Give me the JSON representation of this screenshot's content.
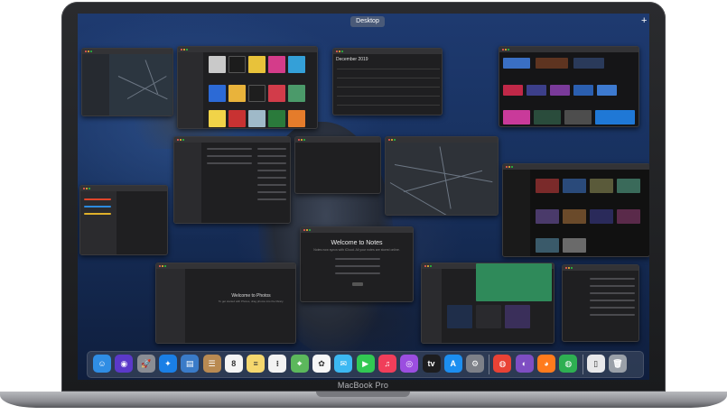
{
  "mission_control": {
    "space_label": "Desktop",
    "add_space_symbol": "+"
  },
  "calendar": {
    "month_title": "December 2019"
  },
  "notes": {
    "welcome_title": "Welcome to Notes",
    "welcome_subtitle": "Notes now syncs with iCloud. All your notes are stored online."
  },
  "photos": {
    "welcome_title": "Welcome to Photos",
    "welcome_subtitle": "To get started with Photos, drag photos into the library."
  },
  "laptop": {
    "model_label": "MacBook Pro"
  },
  "dock": {
    "icons": [
      {
        "name": "finder-icon",
        "glyph": "☺",
        "color": "#2f8de4"
      },
      {
        "name": "siri-icon",
        "glyph": "◉",
        "color": "#5b39c9"
      },
      {
        "name": "launchpad-icon",
        "glyph": "🚀",
        "color": "#8a8d94"
      },
      {
        "name": "safari-icon",
        "glyph": "✦",
        "color": "#1a7fe6"
      },
      {
        "name": "preview-icon",
        "glyph": "▤",
        "color": "#3a7bc8"
      },
      {
        "name": "contacts-icon",
        "glyph": "☰",
        "color": "#b98a52"
      },
      {
        "name": "calendar-icon",
        "glyph": "8",
        "color": "#f4f4f4"
      },
      {
        "name": "notes-icon",
        "glyph": "≡",
        "color": "#f5d76e"
      },
      {
        "name": "reminders-icon",
        "glyph": "⁝",
        "color": "#f2f2f2"
      },
      {
        "name": "maps-icon",
        "glyph": "⌖",
        "color": "#5cb85c"
      },
      {
        "name": "photos-icon",
        "glyph": "✿",
        "color": "#f7f7f7"
      },
      {
        "name": "messages-icon",
        "glyph": "✉",
        "color": "#3cb8f2"
      },
      {
        "name": "facetime-icon",
        "glyph": "▶",
        "color": "#32c853"
      },
      {
        "name": "music-icon",
        "glyph": "♫",
        "color": "#f03e5a"
      },
      {
        "name": "podcasts-icon",
        "glyph": "◎",
        "color": "#9b4ee0"
      },
      {
        "name": "tv-icon",
        "glyph": "tv",
        "color": "#1d1d1f"
      },
      {
        "name": "app-store-icon",
        "glyph": "A",
        "color": "#1c8ef0"
      },
      {
        "name": "system-preferences-icon",
        "glyph": "⚙",
        "color": "#7d8088"
      },
      {
        "name": "chrome-icon",
        "glyph": "◍",
        "color": "#e94235"
      },
      {
        "name": "tor-browser-icon",
        "glyph": "◐",
        "color": "#7e4ec2"
      },
      {
        "name": "firefox-icon",
        "glyph": "◕",
        "color": "#ff7b1d"
      },
      {
        "name": "chrome-canary-icon",
        "glyph": "◍",
        "color": "#2eaf52"
      },
      {
        "name": "document-icon",
        "glyph": "▯",
        "color": "#e8e8ea"
      },
      {
        "name": "trash-icon",
        "glyph": "🗑",
        "color": "#9aa0a8"
      }
    ]
  }
}
